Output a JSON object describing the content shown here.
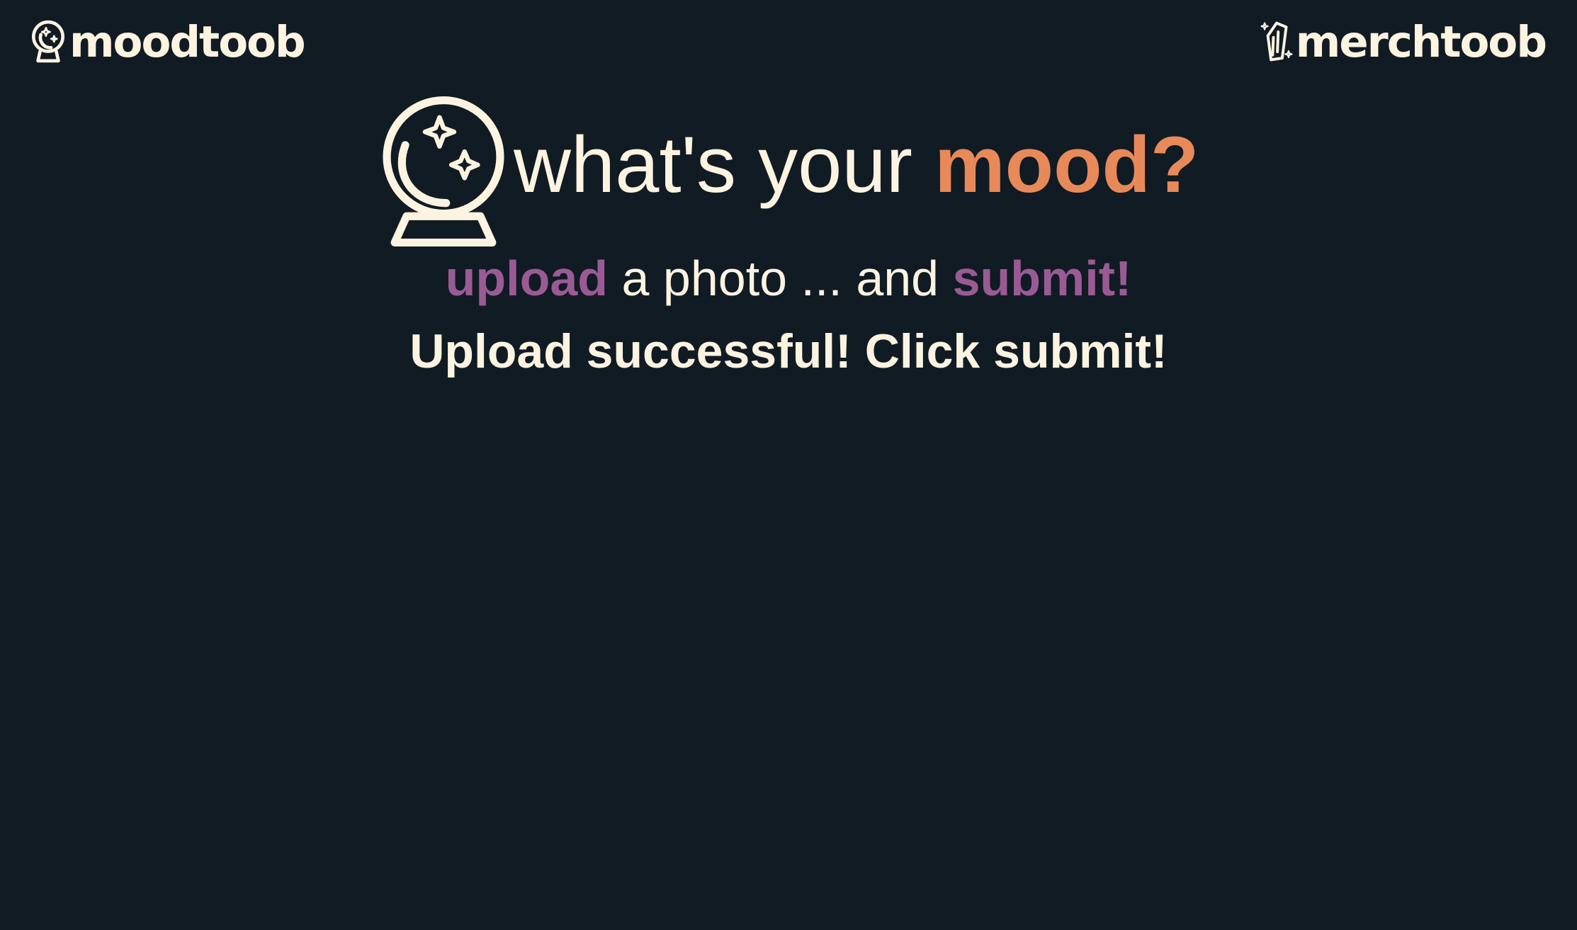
{
  "header": {
    "left_brand": {
      "label": "moodtoob",
      "icon": "crystal-ball-icon"
    },
    "right_brand": {
      "label": "merchtoob",
      "icon": "crystal-icon"
    }
  },
  "hero": {
    "icon": "crystal-ball-icon",
    "title_prefix": "what's your ",
    "title_accent": "mood?"
  },
  "instruction": {
    "upload": "upload",
    "middle": " a photo ... and ",
    "submit": "submit!"
  },
  "status": {
    "message": "Upload successful! Click submit!"
  },
  "colors": {
    "background": "#111b24",
    "text": "#fdf3e1",
    "accent_orange": "#e8895a",
    "accent_purple": "#9a5b95"
  }
}
